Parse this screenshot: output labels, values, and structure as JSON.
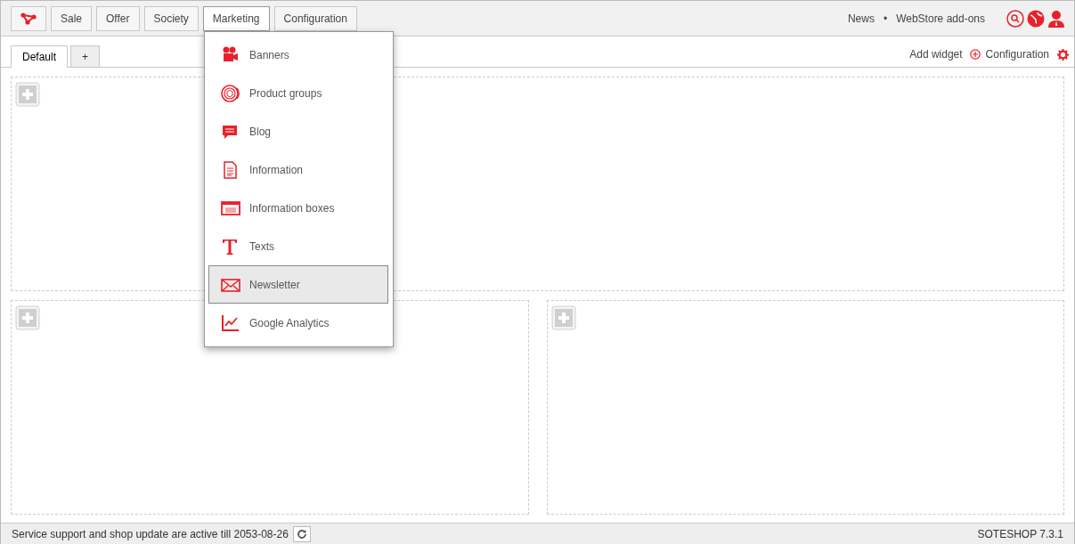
{
  "nav": [
    {
      "label": "Sale",
      "selected": false
    },
    {
      "label": "Offer",
      "selected": false
    },
    {
      "label": "Society",
      "selected": false
    },
    {
      "label": "Marketing",
      "selected": true
    },
    {
      "label": "Configuration",
      "selected": false
    }
  ],
  "top_links": [
    "News",
    "•",
    "WebStore add-ons"
  ],
  "page_tabs": [
    {
      "label": "Default",
      "selected": true
    },
    {
      "label": "+",
      "selected": false
    }
  ],
  "toolbar": {
    "add_widget": "Add widget",
    "configuration": "Configuration"
  },
  "menu": [
    {
      "label": "Banners",
      "selected": false
    },
    {
      "label": "Product groups",
      "selected": false
    },
    {
      "label": "Blog",
      "selected": false
    },
    {
      "label": "Information",
      "selected": false
    },
    {
      "label": "Information boxes",
      "selected": false
    },
    {
      "label": "Texts",
      "selected": false
    },
    {
      "label": "Newsletter",
      "selected": true
    },
    {
      "label": "Google Analytics",
      "selected": false
    }
  ],
  "status_bar": {
    "message": "Service support and shop update are active till 2053-08-26",
    "version": "SOTESHOP 7.3.1"
  }
}
